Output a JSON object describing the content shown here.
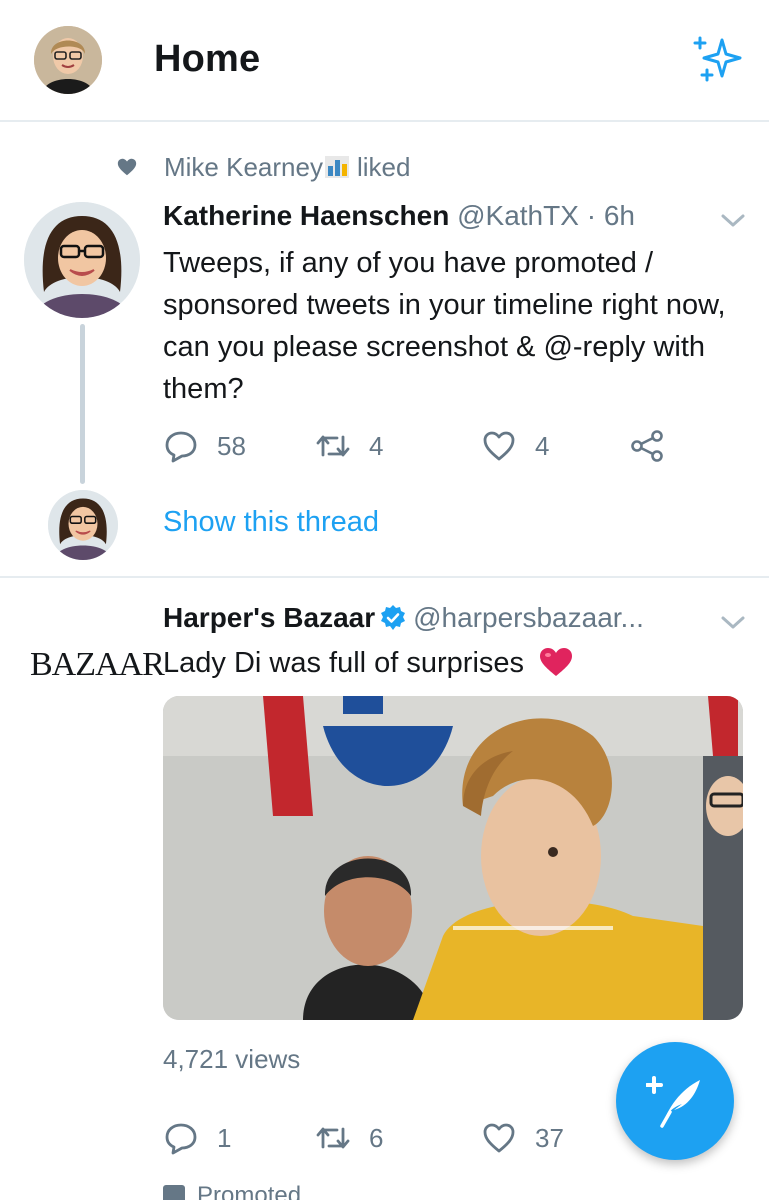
{
  "header": {
    "title": "Home",
    "avatar_icon": "profile-avatar",
    "sparkle_icon": "sparkle-icon"
  },
  "tweet1": {
    "social_context": {
      "liker": "Mike Kearney",
      "liker_emoji": "bar-chart-emoji",
      "action": "liked"
    },
    "author_name": "Katherine Haenschen",
    "author_handle": "@KathTX",
    "separator": "·",
    "time": "6h",
    "text": "Tweeps, if any of you have promoted / sponsored tweets in your timeline right now, can you please screenshot & @-reply with them?",
    "replies": "58",
    "retweets": "4",
    "likes": "4",
    "show_thread": "Show this thread"
  },
  "tweet2": {
    "logo_text": "BAZAAR",
    "author_name": "Harper's Bazaar",
    "author_handle": "@harpersbazaar...",
    "text": "Lady Di was full of surprises",
    "text_emoji": "red-heart-emoji",
    "views": "4,721 views",
    "replies": "1",
    "retweets": "6",
    "likes": "37",
    "promoted_label": "Promoted"
  },
  "colors": {
    "accent": "#1da1f2",
    "secondary_text": "#657786",
    "primary_text": "#14171a",
    "divider": "#e6ecf0",
    "verified": "#1da1f2",
    "heart_emoji": "#e0245e"
  }
}
